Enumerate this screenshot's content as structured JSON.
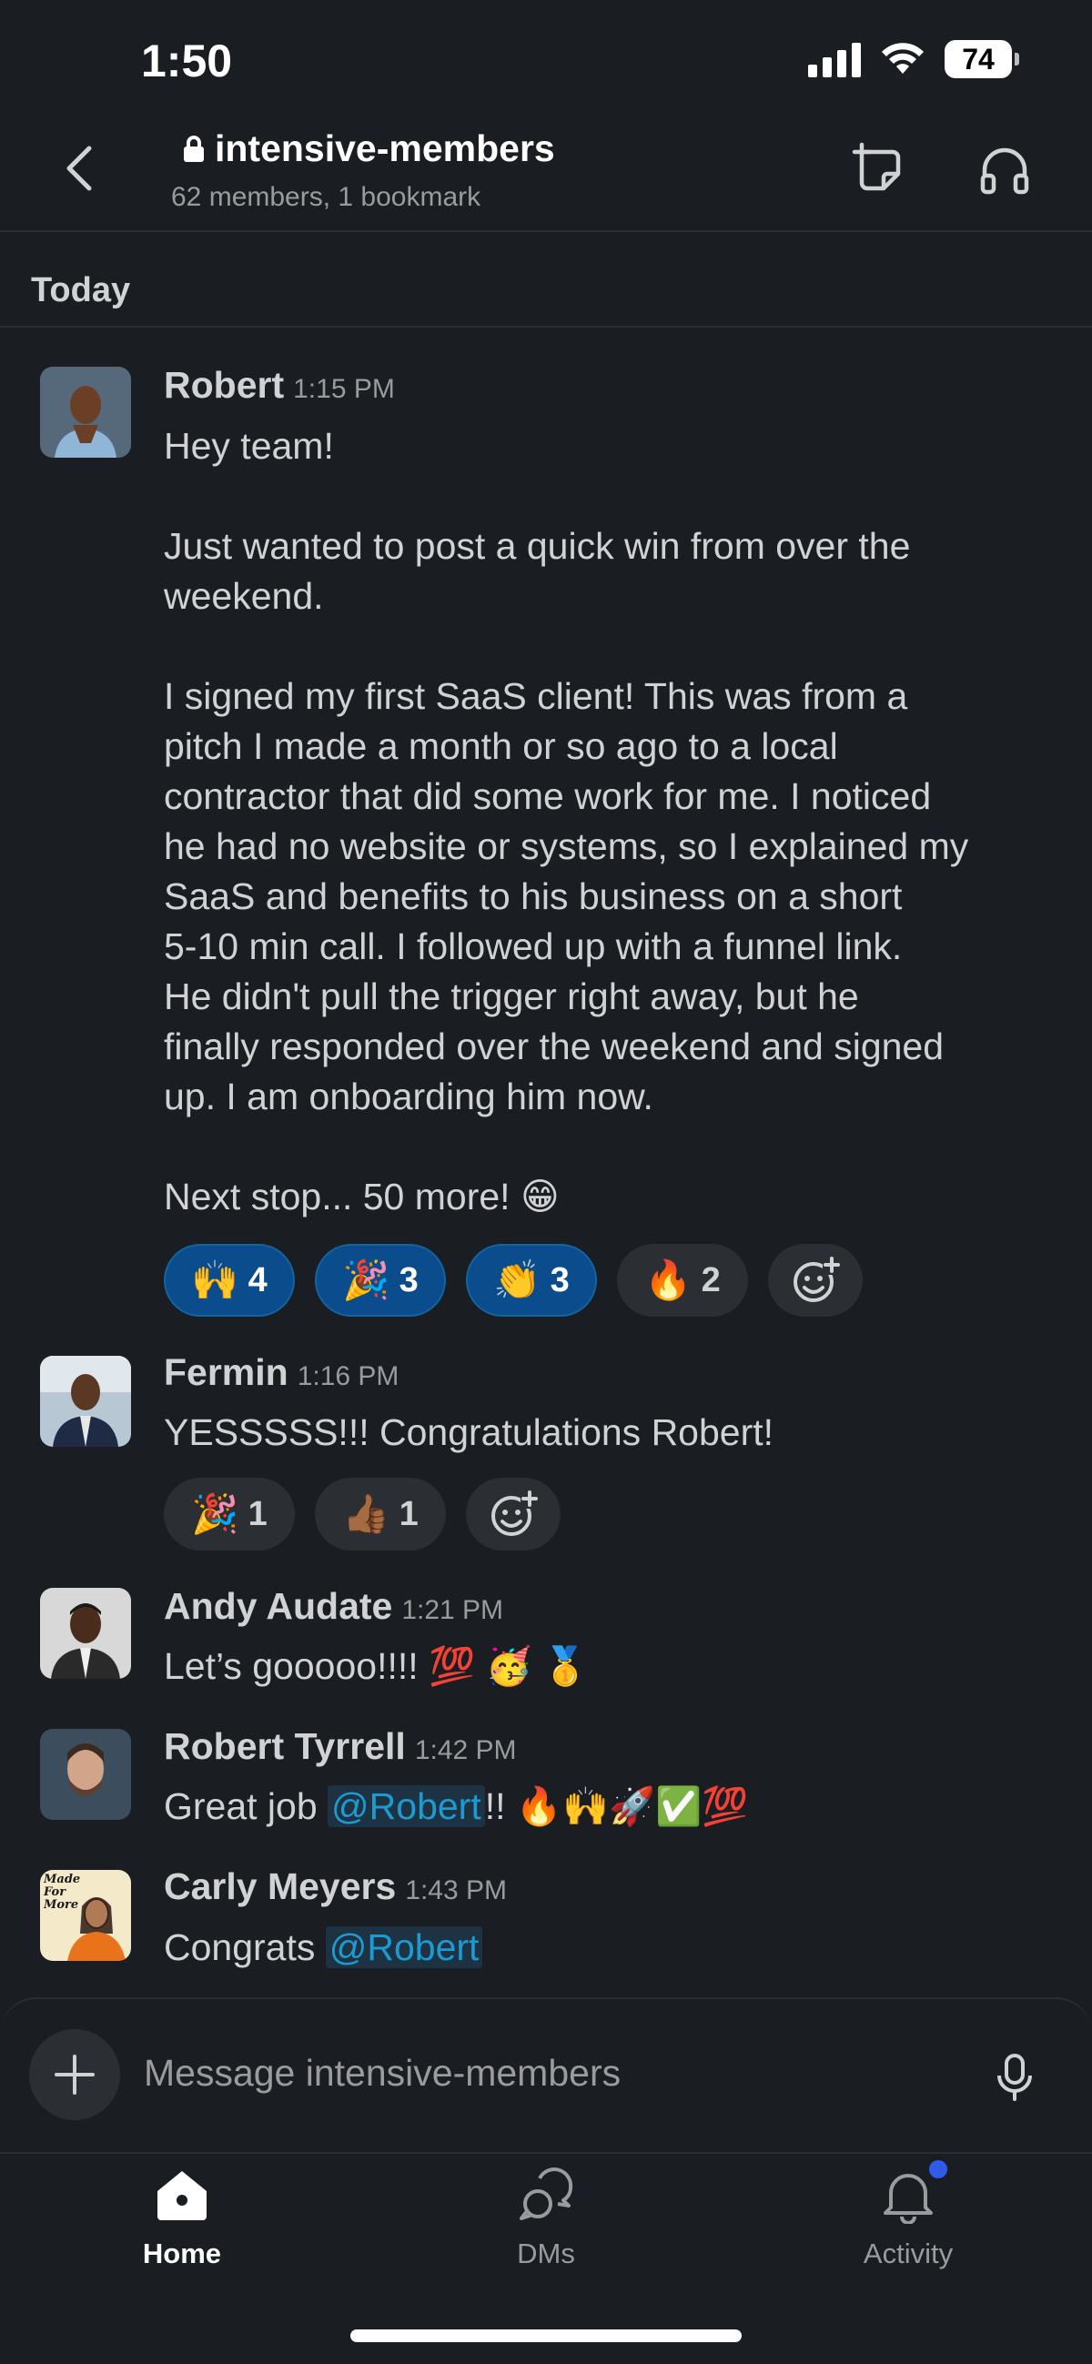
{
  "status_bar": {
    "time": "1:50",
    "battery": "74"
  },
  "header": {
    "channel_name": "intensive-members",
    "subtitle": "62 members, 1 bookmark"
  },
  "day_divider": "Today",
  "messages": [
    {
      "author": "Robert",
      "time": "1:15 PM",
      "lines": [
        "Hey team!",
        "",
        "Just wanted to post a quick win from over the",
        "weekend.",
        "",
        "I signed my first SaaS client! This was from a",
        "pitch I made a month or so ago to a local",
        "contractor that did some work for me. I noticed",
        "he had no website or systems, so I explained my",
        "SaaS and benefits to his business on a short",
        "5-10 min call. I followed up with a funnel link.",
        "He didn't pull the trigger right away, but he",
        "finally responded over the weekend and signed",
        "up. I am onboarding him now.",
        "",
        "Next stop... 50 more! 😁"
      ],
      "reactions": [
        {
          "emoji": "🙌",
          "count": "4"
        },
        {
          "emoji": "🎉",
          "count": "3"
        },
        {
          "emoji": "👏",
          "count": "3"
        },
        {
          "emoji": "🔥",
          "count": "2"
        }
      ]
    },
    {
      "author": "Fermin",
      "time": "1:16 PM",
      "text": "YESSSSS!!!  Congratulations Robert!",
      "reactions": [
        {
          "emoji": "🎉",
          "count": "1"
        },
        {
          "emoji": "👍🏾",
          "count": "1"
        }
      ]
    },
    {
      "author": "Andy Audate",
      "time": "1:21 PM",
      "text": "Let’s gooooo!!!! 💯 🥳 🥇"
    },
    {
      "author": "Robert Tyrrell",
      "time": "1:42 PM",
      "text_before": "Great job ",
      "mention": "@Robert",
      "text_after": "!! 🔥🙌🚀✅💯"
    },
    {
      "author": "Carly Meyers",
      "time": "1:43 PM",
      "text_before": "Congrats ",
      "mention": "@Robert",
      "avatar_text": "Made For More"
    }
  ],
  "composer": {
    "placeholder": "Message intensive-members"
  },
  "tabs": [
    {
      "label": "Home",
      "icon": "home-icon",
      "active": true
    },
    {
      "label": "DMs",
      "icon": "dms-icon",
      "active": false
    },
    {
      "label": "Activity",
      "icon": "bell-icon",
      "active": false
    }
  ],
  "colors": {
    "background": "#1a1d21",
    "mention": "#1d9bd1",
    "active_reaction": "#0b4c8c",
    "notification_dot": "#2f5bea"
  }
}
